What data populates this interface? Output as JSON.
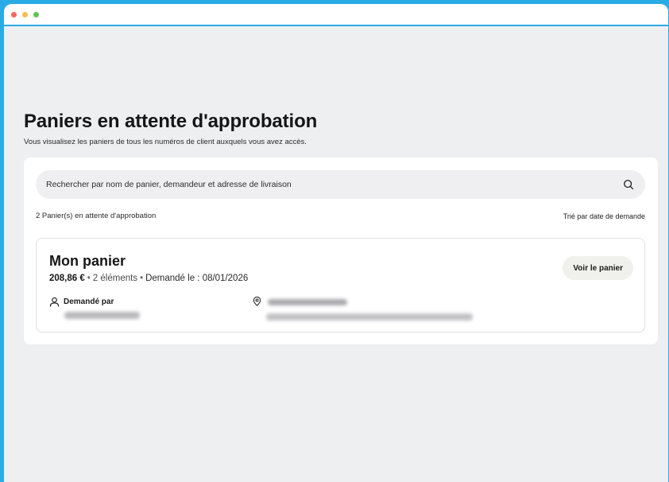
{
  "window": {
    "controls": [
      "close",
      "minimize",
      "maximize"
    ]
  },
  "page": {
    "title": "Paniers en attente d'approbation",
    "subtitle": "Vous visualisez les paniers de tous les numéros de client auxquels vous avez accès."
  },
  "search": {
    "placeholder": "Rechercher par nom de panier, demandeur et adresse de livraison",
    "icon": "search-icon"
  },
  "list": {
    "count_label": "2 Panier(s) en attente d'approbation",
    "sort_label": "Trié par date de demande"
  },
  "cart": {
    "name": "Mon panier",
    "price": "208,86 €",
    "separator": "•",
    "items": "2 éléments",
    "requested_on": "Demandé le : 08/01/2026",
    "button_label": "Voir le panier",
    "requested_by_label": "Demandé par",
    "requester_icon": "person-icon",
    "address_icon": "location-pin-icon"
  },
  "colors": {
    "frame": "#29ace6",
    "background": "#eeeff1",
    "panel": "#ffffff",
    "search_bg": "#efeff1",
    "button_bg": "#f0f0ec",
    "text_primary": "#161616"
  }
}
